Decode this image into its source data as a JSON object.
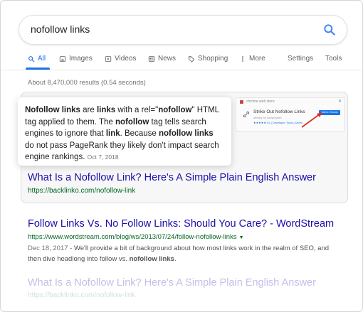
{
  "search": {
    "query": "nofollow links"
  },
  "tabs": [
    {
      "label": "All",
      "icon": "search-icon"
    },
    {
      "label": "Images",
      "icon": "image-icon"
    },
    {
      "label": "Videos",
      "icon": "video-icon"
    },
    {
      "label": "News",
      "icon": "news-icon"
    },
    {
      "label": "Shopping",
      "icon": "tag-icon"
    },
    {
      "label": "More",
      "icon": "more-vert-icon"
    },
    {
      "label": "Settings"
    },
    {
      "label": "Tools"
    }
  ],
  "results_count": "About 8,470,000 results (0.54 seconds)",
  "featured_snippet": {
    "t1": "Nofollow links",
    "t2": " are ",
    "t3": "links",
    "t4": " with a rel=\"",
    "t5": "nofollow",
    "t6": "\" HTML tag applied to them. The ",
    "t7": "nofollow",
    "t8": " tag tells search engines to ignore that ",
    "t9": "link",
    "t10": ". Because ",
    "t11": "nofollow links",
    "t12": " do not pass PageRank they likely don't impact search engine rankings.",
    "date": "Oct 7, 2018",
    "title": "What Is a Nofollow Link? Here's A Simple Plain English Answer",
    "url": "https://backlinko.com/nofollow-link",
    "thumbnail": {
      "store_label": "chrome web store",
      "extension_name": "Strike Out Nofollow Links",
      "sub_label": "offered by nohyeyouth",
      "meta": "★★★★★ 41  |  Developer Tools  |  Users",
      "button_label": "Add to Chrome"
    }
  },
  "results": [
    {
      "title": "Follow Links Vs. No Follow Links: Should You Care? - WordStream",
      "url": "https://www.wordstream.com/blog/ws/2013/07/24/follow-nofollow-links",
      "date": "Dec 18, 2017",
      "d1": " - We'll provide a bit of background about how most links work in the realm of SEO, and then dive headlong into follow vs. ",
      "d2": "nofollow links",
      "d3": "."
    },
    {
      "title": "What Is a Nofollow Link? Here's A Simple Plain English Answer",
      "url": "https://backlinko.com/nofollow-link"
    }
  ],
  "colors": {
    "link": "#1a0dab",
    "url_green": "#006621",
    "accent_blue": "#1a73e8",
    "arrow_red": "#d93025"
  }
}
